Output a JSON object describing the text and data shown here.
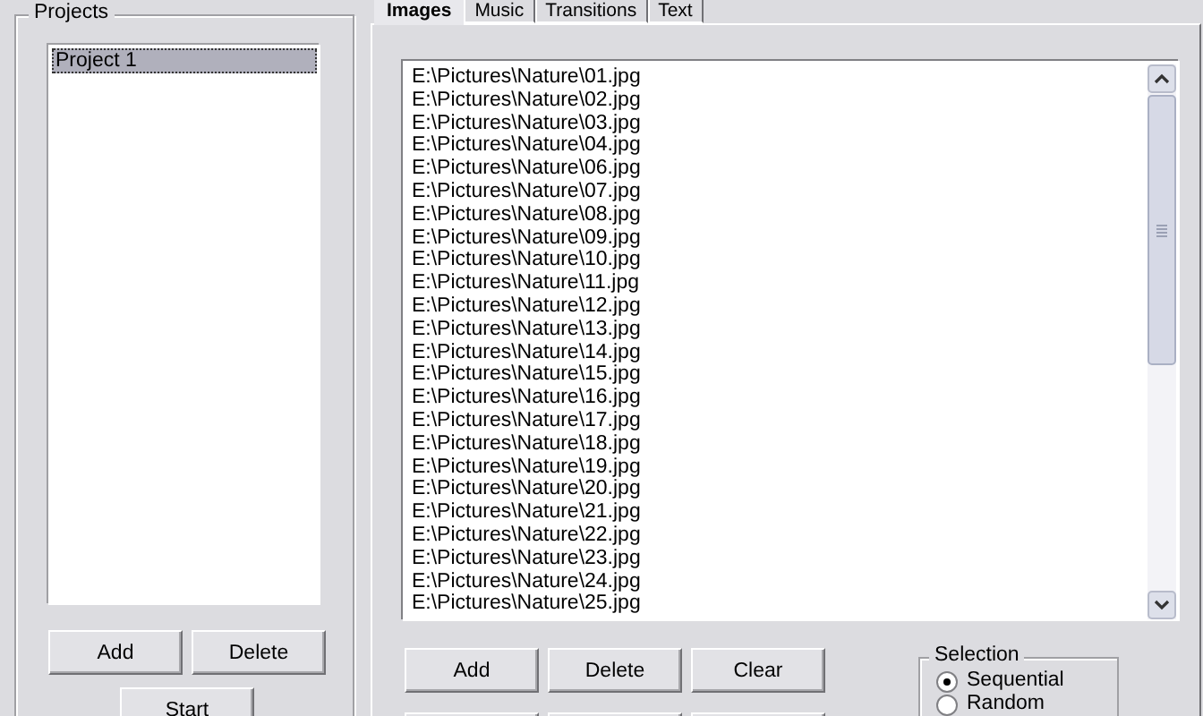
{
  "projects": {
    "title": "Projects",
    "items": [
      {
        "label": "Project 1",
        "selected": true
      }
    ],
    "buttons": [
      "Add",
      "Delete"
    ],
    "start_button": "Start"
  },
  "tabs": [
    {
      "label": "Images",
      "selected": true
    },
    {
      "label": "Music",
      "selected": false
    },
    {
      "label": "Transitions",
      "selected": false
    },
    {
      "label": "Text",
      "selected": false
    }
  ],
  "images": {
    "files": [
      "E:\\Pictures\\Nature\\01.jpg",
      "E:\\Pictures\\Nature\\02.jpg",
      "E:\\Pictures\\Nature\\03.jpg",
      "E:\\Pictures\\Nature\\04.jpg",
      "E:\\Pictures\\Nature\\06.jpg",
      "E:\\Pictures\\Nature\\07.jpg",
      "E:\\Pictures\\Nature\\08.jpg",
      "E:\\Pictures\\Nature\\09.jpg",
      "E:\\Pictures\\Nature\\10.jpg",
      "E:\\Pictures\\Nature\\11.jpg",
      "E:\\Pictures\\Nature\\12.jpg",
      "E:\\Pictures\\Nature\\13.jpg",
      "E:\\Pictures\\Nature\\14.jpg",
      "E:\\Pictures\\Nature\\15.jpg",
      "E:\\Pictures\\Nature\\16.jpg",
      "E:\\Pictures\\Nature\\17.jpg",
      "E:\\Pictures\\Nature\\18.jpg",
      "E:\\Pictures\\Nature\\19.jpg",
      "E:\\Pictures\\Nature\\20.jpg",
      "E:\\Pictures\\Nature\\21.jpg",
      "E:\\Pictures\\Nature\\22.jpg",
      "E:\\Pictures\\Nature\\23.jpg",
      "E:\\Pictures\\Nature\\24.jpg",
      "E:\\Pictures\\Nature\\25.jpg"
    ],
    "buttons": [
      "Add",
      "Delete",
      "Clear"
    ],
    "selection": {
      "title": "Selection",
      "options": [
        {
          "label": "Sequential",
          "selected": true
        },
        {
          "label": "Random",
          "selected": false
        }
      ]
    }
  }
}
